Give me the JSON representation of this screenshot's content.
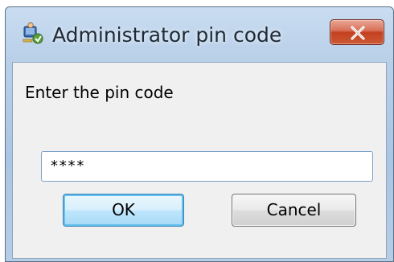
{
  "window": {
    "title": "Administrator pin code"
  },
  "dialog": {
    "prompt": "Enter the pin code",
    "pin_value": "****",
    "ok_label": "OK",
    "cancel_label": "Cancel"
  },
  "icons": {
    "app": "user-key-icon",
    "close": "close-icon"
  },
  "colors": {
    "close_button": "#c4401f",
    "ok_button_border": "#3c7fb1",
    "client_background": "#f0f0f0"
  }
}
